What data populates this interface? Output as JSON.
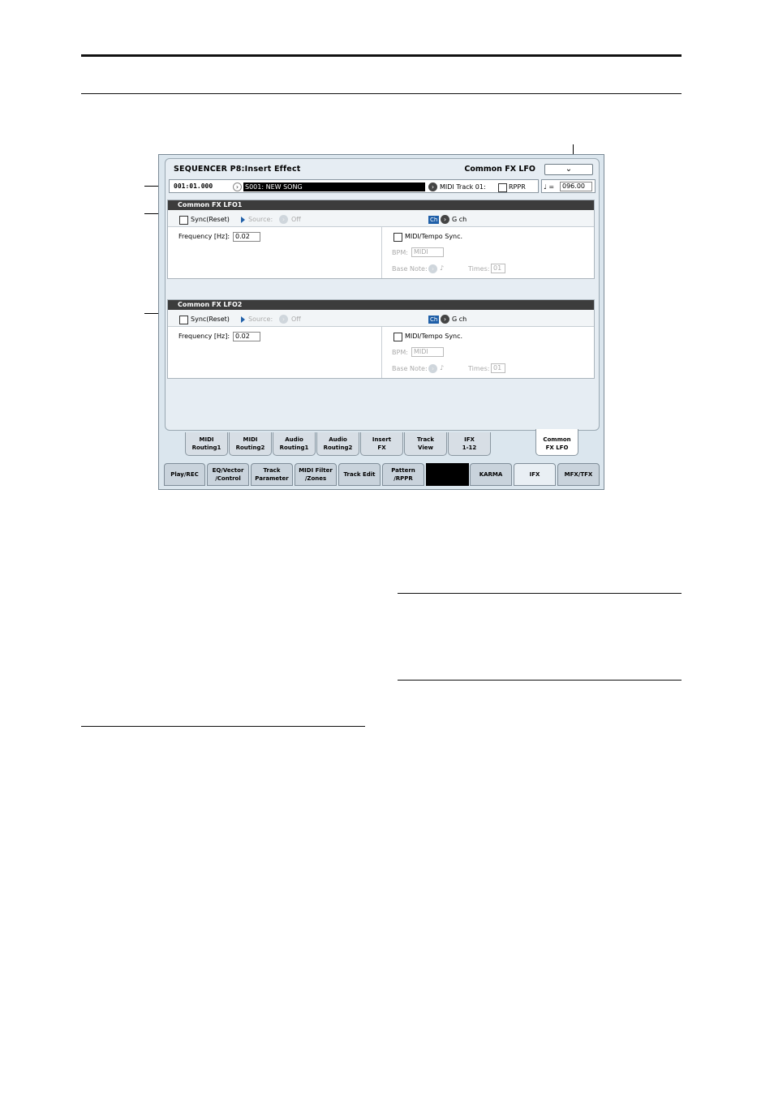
{
  "header": {
    "title": "SEQUENCER P8:Insert Effect",
    "page": "Common FX LFO",
    "menu_glyph": "⌄"
  },
  "info": {
    "location": "001:01.000",
    "song": "S001: NEW SONG",
    "midi_track": "MIDI Track 01:",
    "rppr": "RPPR",
    "tempo_symbol": "♩ =",
    "tempo": "096.00"
  },
  "lfo1": {
    "title": "Common FX LFO1",
    "sync": "Sync(Reset)",
    "source_label": "Source:",
    "source_value": "Off",
    "ch_badge": "Ch",
    "gch": "G ch",
    "freq_label": "Frequency [Hz]:",
    "freq_value": "0.02",
    "tempo_sync": "MIDI/Tempo Sync.",
    "bpm_label": "BPM:",
    "bpm_value": "MIDI",
    "base_note": "Base Note:",
    "base_note_value": "♪",
    "times_label": "Times:",
    "times_value": "01"
  },
  "lfo2": {
    "title": "Common FX LFO2",
    "sync": "Sync(Reset)",
    "source_label": "Source:",
    "source_value": "Off",
    "ch_badge": "Ch",
    "gch": "G ch",
    "freq_label": "Frequency [Hz]:",
    "freq_value": "0.02",
    "tempo_sync": "MIDI/Tempo Sync.",
    "bpm_label": "BPM:",
    "bpm_value": "MIDI",
    "base_note": "Base Note:",
    "base_note_value": "♪",
    "times_label": "Times:",
    "times_value": "01"
  },
  "subtabs": [
    {
      "l1": "MIDI",
      "l2": "Routing1"
    },
    {
      "l1": "MIDI",
      "l2": "Routing2"
    },
    {
      "l1": "Audio",
      "l2": "Routing1"
    },
    {
      "l1": "Audio",
      "l2": "Routing2"
    },
    {
      "l1": "Insert",
      "l2": "FX"
    },
    {
      "l1": "Track",
      "l2": "View"
    },
    {
      "l1": "IFX",
      "l2": "1-12"
    },
    {
      "l1": "Common",
      "l2": "FX LFO"
    }
  ],
  "maintabs": [
    {
      "l1": "Play/REC",
      "l2": ""
    },
    {
      "l1": "EQ/Vector",
      "l2": "/Control"
    },
    {
      "l1": "Track",
      "l2": "Parameter"
    },
    {
      "l1": "MIDI Filter",
      "l2": "/Zones"
    },
    {
      "l1": "Track Edit",
      "l2": ""
    },
    {
      "l1": "Pattern",
      "l2": "/RPPR"
    },
    {
      "l1": "KARMA",
      "l2": ""
    },
    {
      "l1": "IFX",
      "l2": ""
    },
    {
      "l1": "MFX/TFX",
      "l2": ""
    }
  ]
}
